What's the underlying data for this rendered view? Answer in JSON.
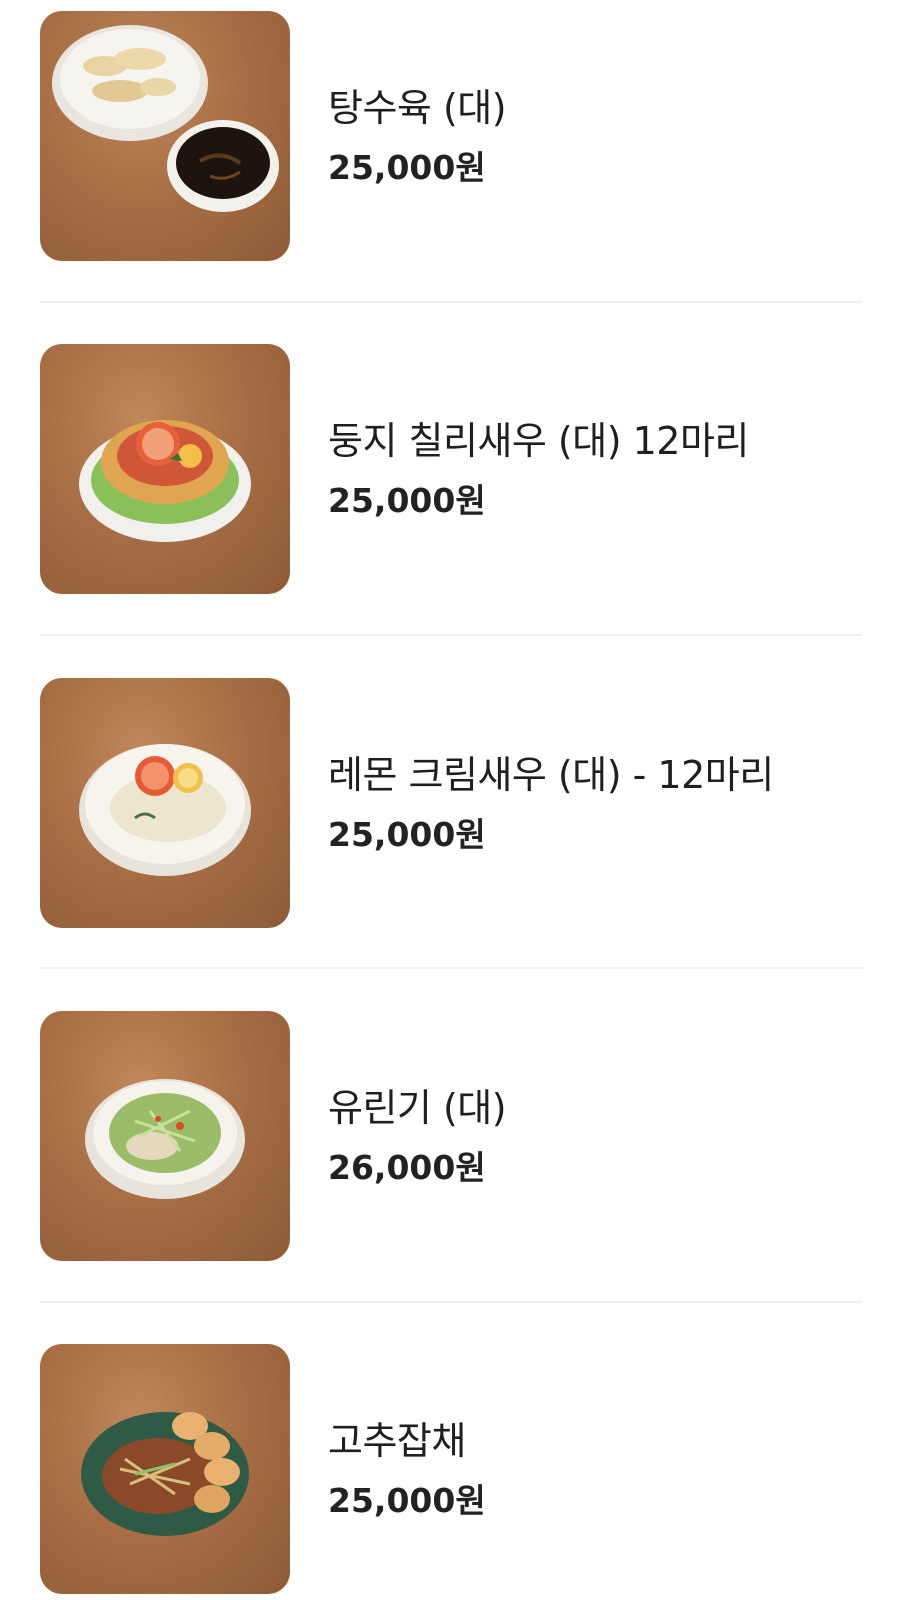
{
  "menu": {
    "items": [
      {
        "name": "탕수육 (대)",
        "price": "25,000원",
        "image": "sweet-and-sour-pork-photo"
      },
      {
        "name": "둥지 칠리새우 (대) 12마리",
        "price": "25,000원",
        "image": "nest-chili-shrimp-photo"
      },
      {
        "name": "레몬 크림새우 (대) - 12마리",
        "price": "25,000원",
        "image": "lemon-cream-shrimp-photo"
      },
      {
        "name": "유린기 (대)",
        "price": "26,000원",
        "image": "yuringi-photo"
      },
      {
        "name": "고추잡채",
        "price": "25,000원",
        "image": "pepper-japchae-photo"
      }
    ]
  },
  "colors": {
    "text": "#222222",
    "divider": "#f0f0f0",
    "table_wood": "#a86f45"
  }
}
